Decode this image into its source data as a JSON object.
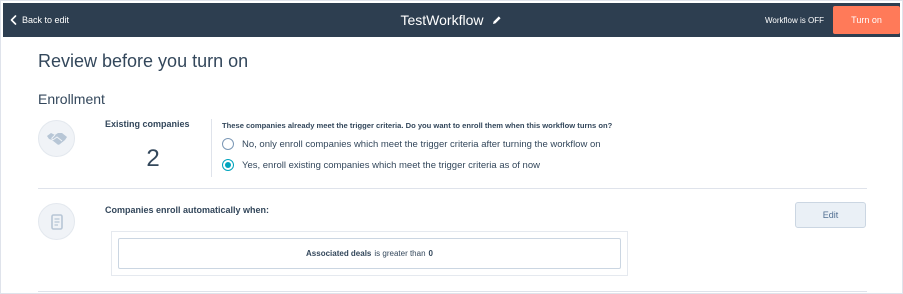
{
  "topbar": {
    "back_label": "Back to edit",
    "workflow_title": "TestWorkflow",
    "status_text": "Workflow is OFF",
    "turn_on_label": "Turn on",
    "accent_color": "#ff7a59",
    "bar_color": "#2d3e50"
  },
  "page": {
    "heading": "Review before you turn on"
  },
  "enrollment": {
    "heading": "Enrollment",
    "existing_label": "Existing companies",
    "existing_count": "2",
    "question": "These companies already meet the trigger criteria. Do you want to enroll them when this workflow turns on?",
    "options": [
      {
        "label": "No, only enroll companies which meet the trigger criteria after turning the workflow on",
        "selected": false
      },
      {
        "label": "Yes, enroll existing companies which meet the trigger criteria as of now",
        "selected": true
      }
    ],
    "auto_label": "Companies enroll automatically when:",
    "edit_label": "Edit",
    "criteria": {
      "property": "Associated deals",
      "operator": "is greater than",
      "value": "0"
    }
  },
  "icons": {
    "back": "chevron-left-icon",
    "edit_title": "pencil-icon",
    "existing": "handshake-icon",
    "auto": "scroll-icon"
  }
}
